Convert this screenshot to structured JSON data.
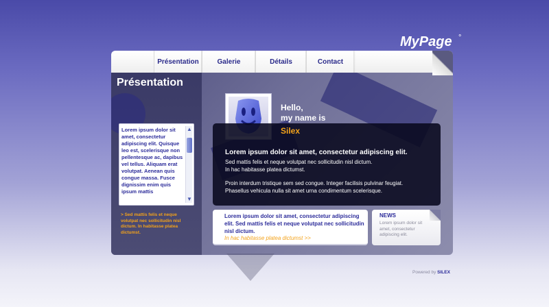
{
  "logo": {
    "text": "MyPage",
    "mark": "°"
  },
  "nav": {
    "tabs": [
      {
        "label": "Présentation"
      },
      {
        "label": "Galerie"
      },
      {
        "label": "Détails"
      },
      {
        "label": "Contact"
      }
    ]
  },
  "sidebar": {
    "title": "Présentation",
    "scroll_text": "Lorem ipsum dolor sit amet, consectetur adipiscing elit. Quisque leo est, scelerisque non pellentesque ac, dapibus vel tellus. Aliquam erat volutpat. Aenean quis congue massa. Fusce dignissim enim quis ipsum mattis",
    "note": "> Sed mattis felis et neque volutpat nec sollicitudin nisl dictum. In habitasse platea dictumst."
  },
  "profile": {
    "hello_line1": "Hello,",
    "hello_line2": "my name is",
    "name": "Silex",
    "avatar_icon": "smiley-robot-icon"
  },
  "intro": {
    "heading": "Lorem ipsum dolor sit amet, consectetur adipiscing elit.",
    "line1": "Sed mattis felis et neque volutpat nec sollicitudin nisl dictum.",
    "line2": "In hac habitasse platea dictumst.",
    "para2_line1": "Proin interdum tristique sem sed congue. Integer facilisis pulvinar feugiat.",
    "para2_line2": "Phasellus vehicula nulla sit amet urna condimentum scelerisque."
  },
  "info_box": {
    "text": "Lorem ipsum dolor sit amet, consectetur adipiscing elit. Sed mattis felis et neque volutpat nec sollicitudin nisl dictum.",
    "link": "In hac habitasse platea dictumst  >>"
  },
  "news": {
    "title": "NEWS",
    "text": "Lorem ipsum dolor sit amet, consectetur adipiscing elit."
  },
  "footer": {
    "powered_prefix": "Powered by",
    "powered_brand": "SILEX"
  },
  "colors": {
    "accent_orange": "#f3a21a",
    "text_blue": "#2c2c9a"
  }
}
